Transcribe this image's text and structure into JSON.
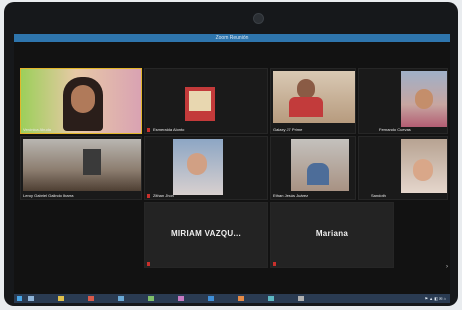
{
  "window": {
    "title": "Zoom Reunión"
  },
  "participants": [
    {
      "name": "Verónica Abuda"
    },
    {
      "name": "Esmeralda Alonto"
    },
    {
      "name": "Galaxy J7 Prime"
    },
    {
      "name": "Fernando Cuevas"
    },
    {
      "name": "Leroy Gabriel Galindo Ibarra"
    },
    {
      "name": "Zithan Jhon"
    },
    {
      "name": "Ethan Jesús Juárez"
    },
    {
      "name": "Sandoth"
    },
    {
      "name": "MIRIAM VAZQU..."
    },
    {
      "name": "Mariana"
    }
  ],
  "colors": {
    "titlebar": "#2e75ad",
    "stage": "#121212",
    "taskbar": "#2a3b52"
  }
}
